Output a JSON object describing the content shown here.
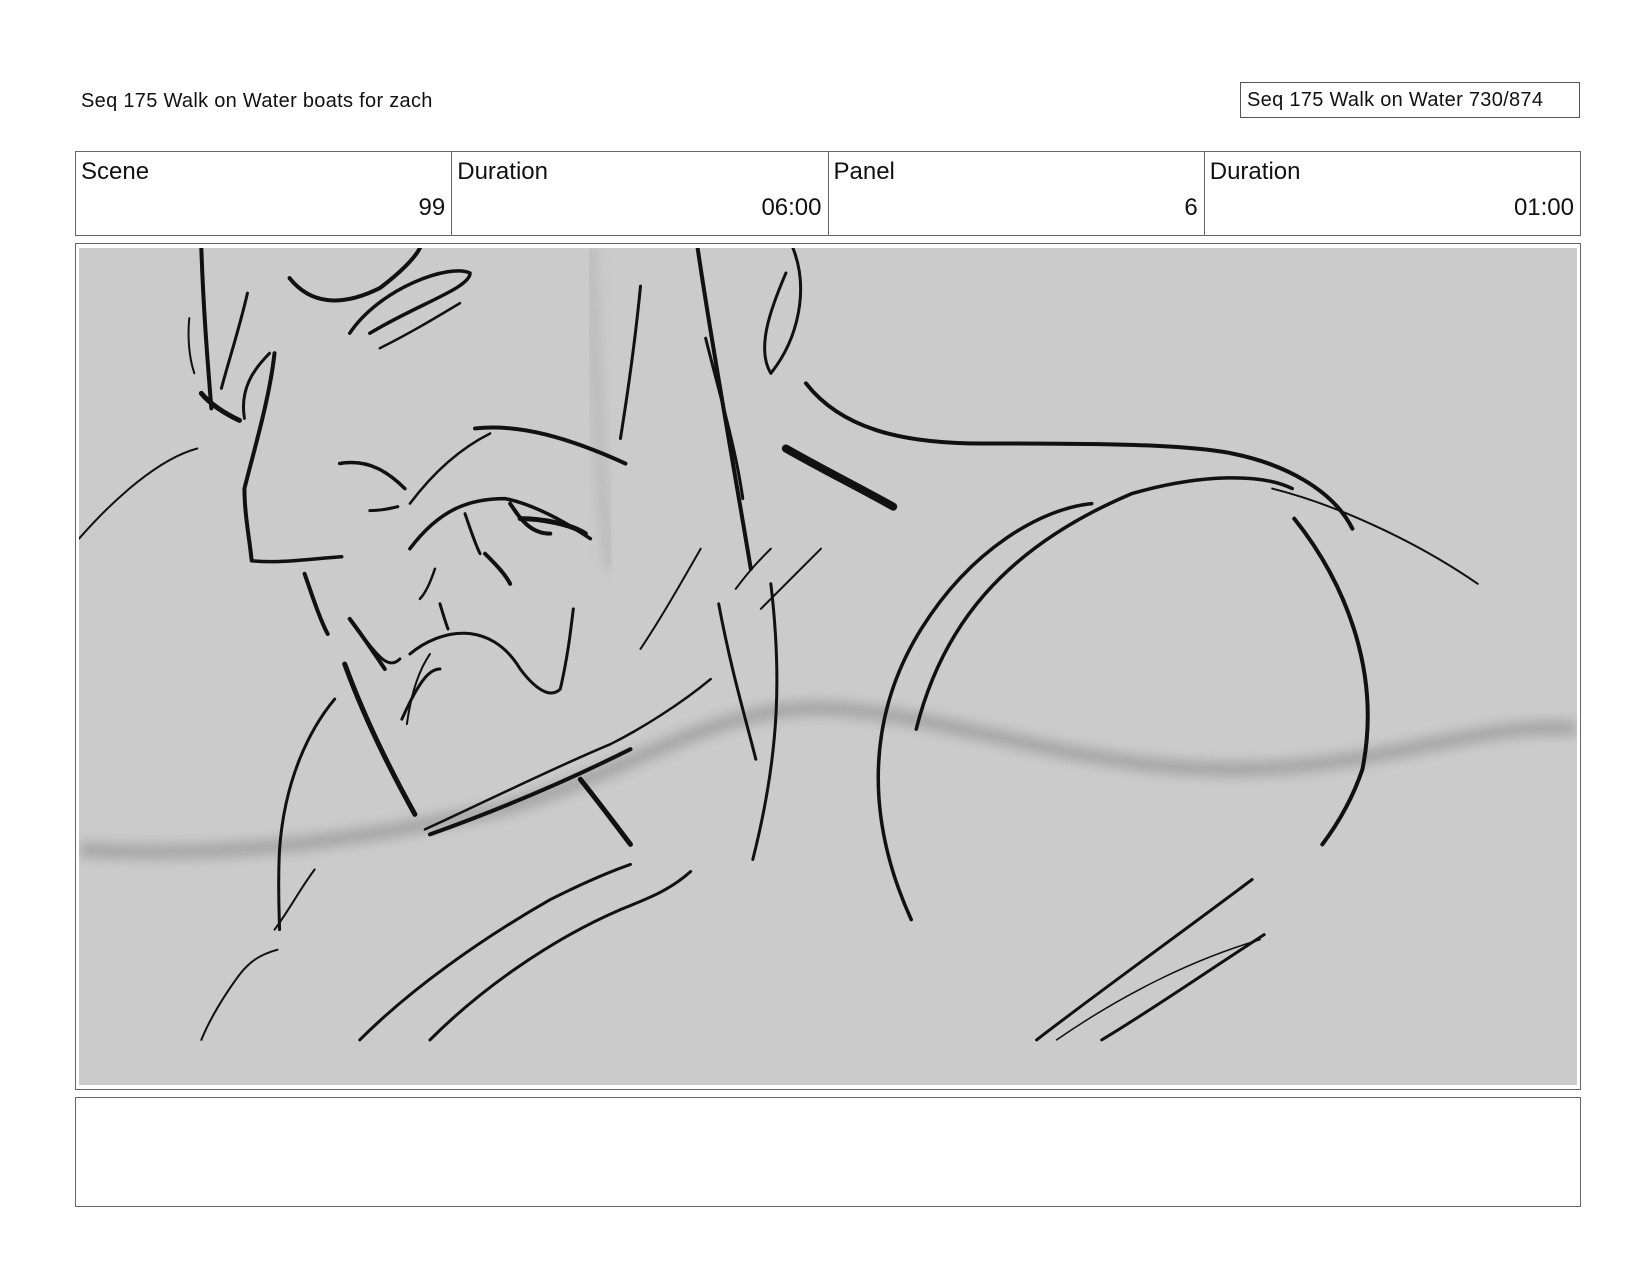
{
  "header": {
    "title": "Seq 175 Walk on Water  boats for zach",
    "page_label": "Seq 175 Walk on Water 730/874"
  },
  "info": [
    {
      "label": "Scene",
      "value": "99"
    },
    {
      "label": "Duration",
      "value": "06:00"
    },
    {
      "label": "Panel",
      "value": "6"
    },
    {
      "label": "Duration",
      "value": "01:00"
    }
  ],
  "panel": {
    "background_color": "#cbcbcb",
    "line_color": "#111111"
  },
  "notes": {
    "text": ""
  }
}
